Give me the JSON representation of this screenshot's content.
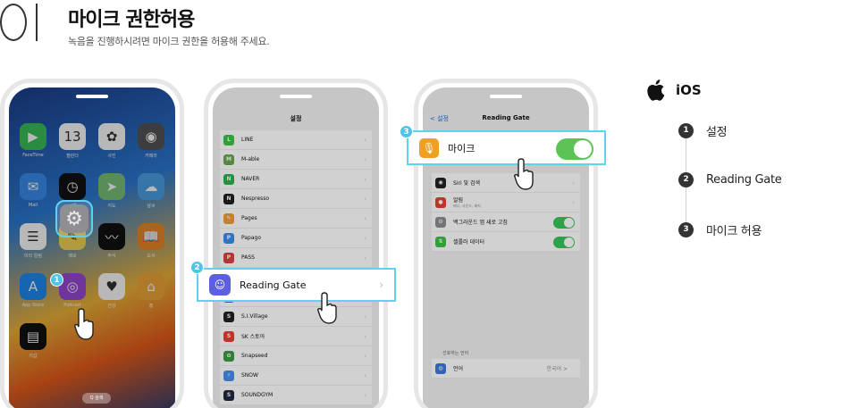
{
  "header": {
    "step_number": "01",
    "title": "마이크 권한허용",
    "subtitle": "녹음을 진행하시려면 마이크 권한을 허용해 주세요."
  },
  "phone1": {
    "apps": [
      {
        "label": "FaceTime",
        "icon": "facetime-icon",
        "color": "#3bc25a",
        "glyph": "▶"
      },
      {
        "label": "캘린더",
        "icon": "calendar-icon",
        "color": "#ffffff",
        "glyph": "13"
      },
      {
        "label": "사진",
        "icon": "photos-icon",
        "color": "#ffffff",
        "glyph": "✿"
      },
      {
        "label": "카메라",
        "icon": "camera-icon",
        "color": "#555555",
        "glyph": "◉"
      },
      {
        "label": "Mail",
        "icon": "mail-icon",
        "color": "#3a8ef0",
        "glyph": "✉"
      },
      {
        "label": "시계",
        "icon": "clock-icon",
        "color": "#111111",
        "glyph": "◷"
      },
      {
        "label": "지도",
        "icon": "maps-icon",
        "color": "#7cc47a",
        "glyph": "➤"
      },
      {
        "label": "날씨",
        "icon": "weather-icon",
        "color": "#4aa3e8",
        "glyph": "☁"
      },
      {
        "label": "미리 알림",
        "icon": "reminders-icon",
        "color": "#ffffff",
        "glyph": "☰"
      },
      {
        "label": "메모",
        "icon": "notes-icon",
        "color": "#f6d75a",
        "glyph": "✎"
      },
      {
        "label": "주식",
        "icon": "stocks-icon",
        "color": "#111111",
        "glyph": "〰"
      },
      {
        "label": "도서",
        "icon": "books-icon",
        "color": "#f08a24",
        "glyph": "📖"
      },
      {
        "label": "App Store",
        "icon": "app-store-icon",
        "color": "#1f8cf5",
        "glyph": "A"
      },
      {
        "label": "Podcast",
        "icon": "podcast-icon",
        "color": "#9b4ad6",
        "glyph": "◎"
      },
      {
        "label": "건강",
        "icon": "health-icon",
        "color": "#ffffff",
        "glyph": "♥"
      },
      {
        "label": "홈",
        "icon": "home-icon",
        "color": "#f2a83a",
        "glyph": "⌂"
      },
      {
        "label": "지갑",
        "icon": "wallet-icon",
        "color": "#111111",
        "glyph": "▤"
      }
    ],
    "search_label": "Q 검색",
    "settings_label": "설정"
  },
  "phone2": {
    "title": "설정",
    "apps": [
      {
        "label": "LINE",
        "color": "#3ec446",
        "glyph": "L"
      },
      {
        "label": "M-able",
        "color": "#6aa84f",
        "glyph": "M"
      },
      {
        "label": "NAVER",
        "color": "#2bb24c",
        "glyph": "N"
      },
      {
        "label": "Nespresso",
        "color": "#222222",
        "glyph": "N"
      },
      {
        "label": "Pages",
        "color": "#f29d38",
        "glyph": "✎"
      },
      {
        "label": "Papago",
        "color": "#3d8ef0",
        "glyph": "P"
      },
      {
        "label": "PASS",
        "color": "#e04040",
        "glyph": "P"
      },
      {
        "label": "Reading Gate",
        "color": "#5b5fe0",
        "glyph": "☺"
      },
      {
        "label": "Reading Gate",
        "color": "#5b5fe0",
        "glyph": "☺"
      },
      {
        "label": "S.I.Village",
        "color": "#222222",
        "glyph": "S"
      },
      {
        "label": "SK 스토아",
        "color": "#e8402f",
        "glyph": "S"
      },
      {
        "label": "Snapseed",
        "color": "#3e9c45",
        "glyph": "✿"
      },
      {
        "label": "SNOW",
        "color": "#4a8ef0",
        "glyph": "⚡"
      },
      {
        "label": "SOUNDGYM",
        "color": "#1f2a44",
        "glyph": "S"
      }
    ],
    "highlight_label": "Reading Gate"
  },
  "phone3": {
    "back_label": "< 설정",
    "title": "Reading Gate",
    "mic_label": "마이크",
    "rows": [
      {
        "label": "Siri 및 검색",
        "color": "#222222",
        "glyph": "◉",
        "control": "chevron"
      },
      {
        "label": "알림",
        "color": "#e8402f",
        "glyph": "●",
        "control": "chevron"
      },
      {
        "label": "백그라운드 앱 새로 고침",
        "color": "#8e8e93",
        "glyph": "⚙",
        "control": "toggle"
      },
      {
        "label": "셀룰러 데이터",
        "color": "#3ec446",
        "glyph": "⇅",
        "control": "toggle"
      }
    ],
    "notif_sub": "배너, 사운드, 배지",
    "section_header": "선호하는 언어",
    "language_label": "언어",
    "language_value": "한국어 >"
  },
  "badges": [
    "1",
    "2",
    "3"
  ],
  "guide": {
    "platform": "iOS",
    "steps": [
      {
        "num": "1",
        "label": "설정"
      },
      {
        "num": "2",
        "label": "Reading Gate"
      },
      {
        "num": "3",
        "label": "마이크 허용"
      }
    ]
  },
  "colors": {
    "accent": "#4fc3e8",
    "toggle_on": "#5cc456",
    "step_dot": "#333333"
  }
}
